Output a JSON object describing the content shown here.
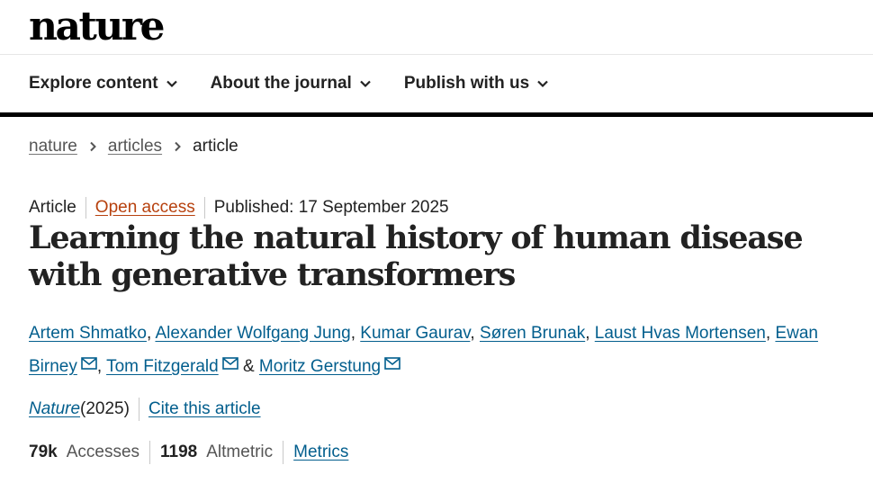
{
  "header": {
    "logo": "nature"
  },
  "nav": {
    "items": [
      {
        "label": "Explore content"
      },
      {
        "label": "About the journal"
      },
      {
        "label": "Publish with us"
      }
    ]
  },
  "breadcrumb": {
    "items": [
      "nature",
      "articles"
    ],
    "current": "article"
  },
  "meta": {
    "type": "Article",
    "access": "Open access",
    "published": "Published: 17 September 2025"
  },
  "title": "Learning the natural history of human disease with generative transformers",
  "authors": [
    "Artem Shmatko",
    "Alexander Wolfgang Jung",
    "Kumar Gaurav",
    "Søren Brunak",
    "Laust Hvas Mortensen",
    "Ewan Birney",
    "Tom Fitzgerald",
    "Moritz Gerstung"
  ],
  "author_separators": {
    "comma": ", ",
    "ampersand": " & "
  },
  "citation": {
    "journal": "Nature",
    "year": " (2025)",
    "cite_link": "Cite this article"
  },
  "metrics": {
    "accesses_value": "79k",
    "accesses_label": "Accesses",
    "altmetric_value": "1198",
    "altmetric_label": "Altmetric",
    "metrics_link": "Metrics"
  },
  "icons": {
    "chevron": "chevron-down-icon",
    "breadcrumb_sep": "chevron-right-icon",
    "mail": "mail-icon"
  },
  "colors": {
    "link": "#025e8d",
    "open_access": "#b7410e",
    "text": "#222222"
  }
}
